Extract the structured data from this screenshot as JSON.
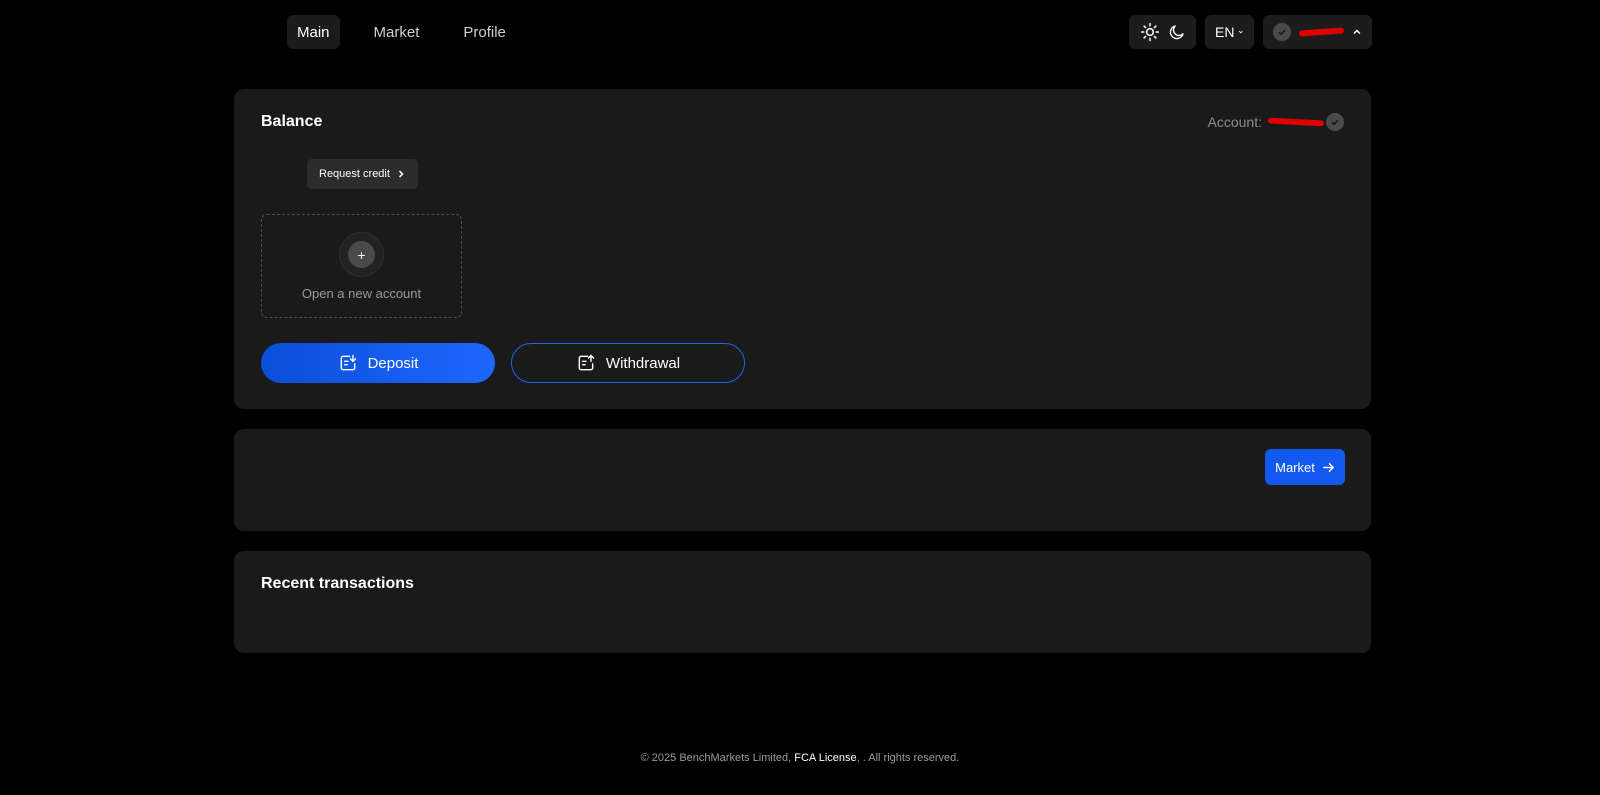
{
  "nav": {
    "items": [
      {
        "label": "Main",
        "active": true
      },
      {
        "label": "Market",
        "active": false
      },
      {
        "label": "Profile",
        "active": false
      }
    ]
  },
  "header": {
    "language": "EN",
    "theme_icons": [
      "sun-icon",
      "moon-icon"
    ],
    "user_icons": [
      "shield-check-icon",
      "chevron-up-icon"
    ]
  },
  "balance": {
    "title": "Balance",
    "account_label": "Account:",
    "request_credit_label": "Request credit",
    "open_account_label": "Open a new account",
    "deposit_label": "Deposit",
    "withdrawal_label": "Withdrawal"
  },
  "market": {
    "button_label": "Market"
  },
  "recent": {
    "title": "Recent transactions"
  },
  "footer": {
    "prefix": "© 2025 BenchMarkets Limited, ",
    "license_link": "FCA License",
    "suffix": ", . All rights reserved."
  },
  "colors": {
    "background": "#000000",
    "card": "#1a1a1a",
    "accent": "#1359ef",
    "redacted": "#e00000"
  }
}
